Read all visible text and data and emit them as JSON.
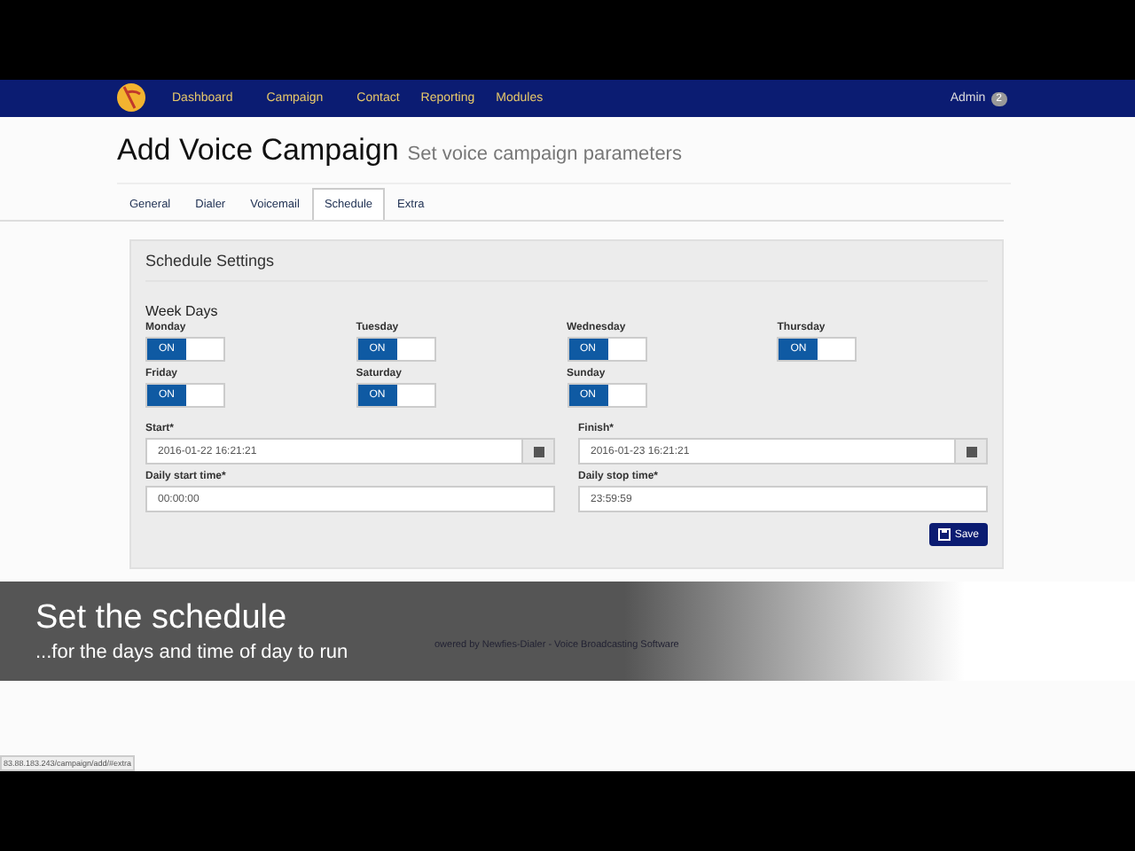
{
  "navbar": {
    "items": [
      {
        "label": "Dashboard",
        "selected": false
      },
      {
        "label": "Campaign",
        "selected": false
      },
      {
        "label": "Contact",
        "selected": false
      },
      {
        "label": "Reporting",
        "selected": false
      },
      {
        "label": "Modules",
        "selected": false
      }
    ],
    "user": "Admin",
    "badge": "2"
  },
  "header": {
    "title": "Add Voice Campaign",
    "subtitle": "Set voice campaign parameters"
  },
  "tabs": [
    {
      "label": "General",
      "selected": false
    },
    {
      "label": "Dialer",
      "selected": false
    },
    {
      "label": "Voicemail",
      "selected": false
    },
    {
      "label": "Schedule",
      "selected": true
    },
    {
      "label": "Extra",
      "selected": false
    }
  ],
  "panel": {
    "title": "Schedule Settings",
    "section": "Week Days",
    "days": [
      {
        "label": "Monday",
        "on": true,
        "switch_text": "ON"
      },
      {
        "label": "Tuesday",
        "on": true,
        "switch_text": "ON"
      },
      {
        "label": "Wednesday",
        "on": true,
        "switch_text": "ON"
      },
      {
        "label": "Thursday",
        "on": true,
        "switch_text": "ON"
      },
      {
        "label": "Friday",
        "on": true,
        "switch_text": "ON"
      },
      {
        "label": "Saturday",
        "on": true,
        "switch_text": "ON"
      },
      {
        "label": "Sunday",
        "on": true,
        "switch_text": "ON"
      }
    ],
    "fields": [
      {
        "label": "Start*",
        "value": "2016-01-22 16:21:21",
        "kind": "date"
      },
      {
        "label": "Finish*",
        "value": "2016-01-23 16:21:21",
        "kind": "date"
      },
      {
        "label": "Daily start time*",
        "value": "00:00:00",
        "kind": "text"
      },
      {
        "label": "Daily stop time*",
        "value": "23:59:59",
        "kind": "text"
      }
    ],
    "save_button": "Save"
  },
  "caption": {
    "title": "Set the schedule",
    "subtitle": "...for the days and time of day to run"
  },
  "footer": "owered by Newfies-Dialer - Voice Broadcasting Software",
  "status_url": "83.88.183.243/campaign/add/#extra"
}
